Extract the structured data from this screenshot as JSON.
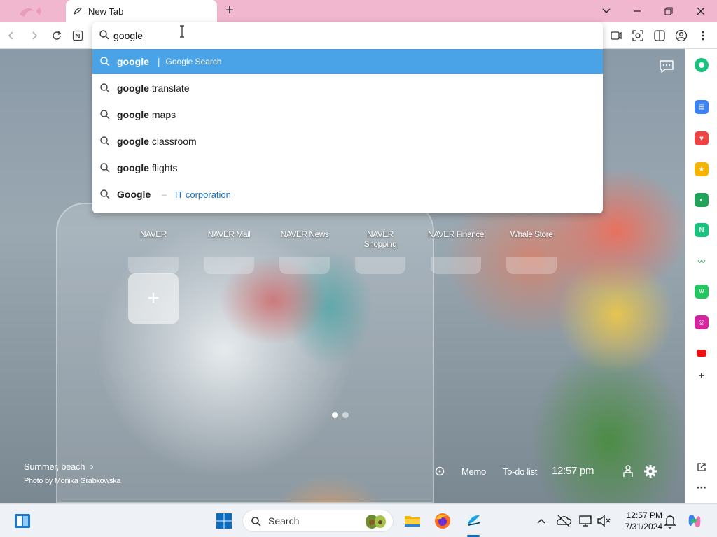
{
  "browser": {
    "tab_title": "New Tab",
    "new_tab_label": "+"
  },
  "omnibox": {
    "input_value": "google",
    "suggestions": [
      {
        "bold": "google",
        "rest": "",
        "desc": "Google Search",
        "selected": true
      },
      {
        "bold": "google",
        "rest": "translate",
        "desc": "",
        "selected": false
      },
      {
        "bold": "google",
        "rest": "maps",
        "desc": "",
        "selected": false
      },
      {
        "bold": "google",
        "rest": "classroom",
        "desc": "",
        "selected": false
      },
      {
        "bold": "google",
        "rest": "flights",
        "desc": "",
        "selected": false
      },
      {
        "bold": "Google",
        "rest": "",
        "entity": "IT corporation",
        "selected": false
      }
    ],
    "separator": "|",
    "dash": "–"
  },
  "shortcuts": [
    {
      "label": "NAVER"
    },
    {
      "label": "NAVER Mail"
    },
    {
      "label": "NAVER News"
    },
    {
      "label": "NAVER Shopping"
    },
    {
      "label": "NAVER Finance"
    },
    {
      "label": "Whale Store"
    }
  ],
  "add_shortcut": "+",
  "background": {
    "title": "Summer, beach",
    "chevron": "›",
    "credit": "Photo by Monika Grabkowska"
  },
  "widgets": {
    "memo": "Memo",
    "todo": "To-do list",
    "time": "12:57 pm"
  },
  "taskbar": {
    "search_placeholder": "Search",
    "time": "12:57 PM",
    "date": "7/31/2024"
  },
  "colors": {
    "tabbar_bg": "#f0b7cf",
    "selected_suggestion": "#4aa3e6",
    "entity_link": "#1a73c8",
    "whale_green": "#19c37d"
  }
}
